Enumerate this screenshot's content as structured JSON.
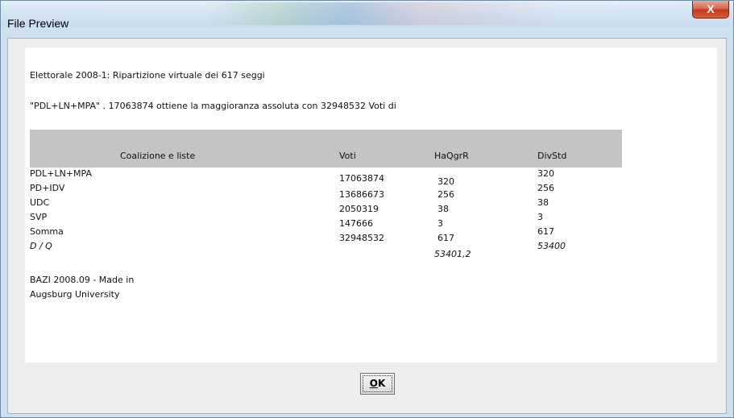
{
  "window": {
    "title": "File Preview",
    "close_label": "X"
  },
  "content": {
    "line1": "Elettorale 2008-1: Ripartizione virtuale dei 617 seggi",
    "line2": "\"PDL+LN+MPA\" . 17063874 ottiene la maggioranza assoluta con 32948532 Voti di",
    "table": {
      "headers": [
        "Coalizione e liste",
        "Voti",
        "HaQgrR",
        "DivStd"
      ],
      "rows": [
        [
          "PDL+LN+MPA",
          "17063874",
          "320",
          "320"
        ],
        [
          "PD+IDV",
          "13686673",
          "256",
          "256"
        ],
        [
          "UDC",
          "2050319",
          "38",
          "38"
        ],
        [
          "SVP",
          "147666",
          "3",
          "3"
        ],
        [
          "Somma",
          "32948532",
          "617",
          "617"
        ],
        [
          "D / Q",
          "",
          "53401,2",
          "53400"
        ]
      ]
    },
    "footer_line1": "BAZI 2008.09 - Made in",
    "footer_line2": "Augsburg University"
  },
  "buttons": {
    "ok_first": "O",
    "ok_rest": "K"
  }
}
